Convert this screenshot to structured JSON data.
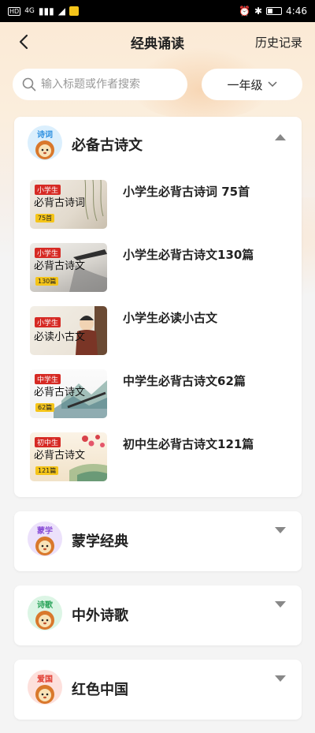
{
  "status_bar": {
    "left_label": "HD",
    "signal": "4G",
    "time": "4:46"
  },
  "nav": {
    "title": "经典诵读",
    "history_label": "历史记录"
  },
  "search": {
    "placeholder": "输入标题或作者搜索",
    "grade_value": "一年级"
  },
  "categories": [
    {
      "tag": "诗词",
      "tag_color": "#2b8fe0",
      "avatar_bg": "#dbeffd",
      "title": "必备古诗文",
      "expanded": true,
      "items": [
        {
          "title": "小学生必背古诗词 75首",
          "cover_badge": "小学生",
          "cover_main": "必背古诗词",
          "cover_num": "75首"
        },
        {
          "title": "小学生必背古诗文130篇",
          "cover_badge": "小学生",
          "cover_main": "必背古诗文",
          "cover_num": "130篇"
        },
        {
          "title": "小学生必读小古文",
          "cover_badge": "小学生",
          "cover_main": "必读小古文",
          "cover_num": ""
        },
        {
          "title": "中学生必背古诗文62篇",
          "cover_badge": "中学生",
          "cover_main": "必背古诗文",
          "cover_num": "62篇"
        },
        {
          "title": "初中生必背古诗文121篇",
          "cover_badge": "初中生",
          "cover_main": "必背古诗文",
          "cover_num": "121篇"
        }
      ]
    },
    {
      "tag": "蒙学",
      "tag_color": "#8a4fd6",
      "avatar_bg": "#ece1fb",
      "title": "蒙学经典",
      "expanded": false
    },
    {
      "tag": "诗歌",
      "tag_color": "#2aa45a",
      "avatar_bg": "#dcf5e5",
      "title": "中外诗歌",
      "expanded": false
    },
    {
      "tag": "爱国",
      "tag_color": "#e0392e",
      "avatar_bg": "#fde0dc",
      "title": "红色中国",
      "expanded": false
    }
  ]
}
